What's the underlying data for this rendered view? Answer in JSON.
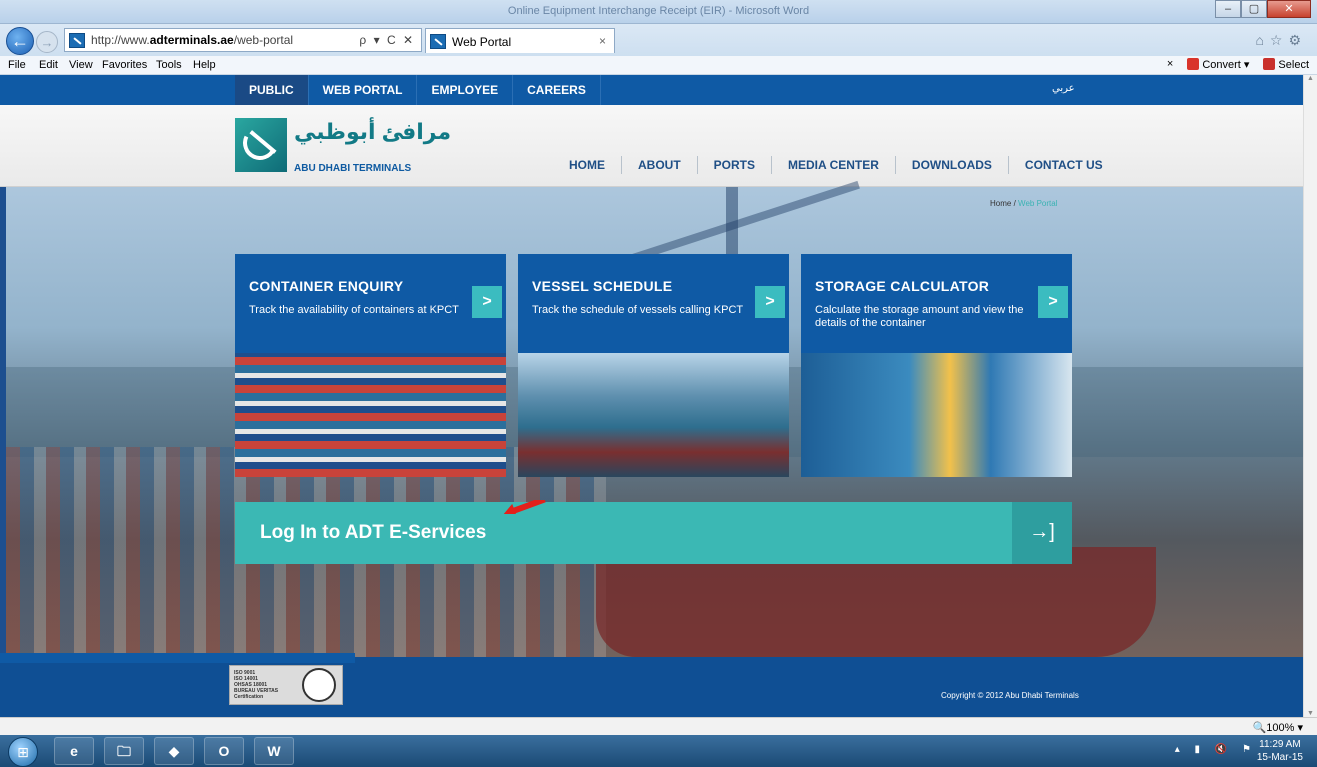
{
  "window": {
    "title": "Online Equipment Interchange Receipt (EIR) - Microsoft Word"
  },
  "browser": {
    "url_prefix": "http://www.",
    "url_domain": "adterminals.ae",
    "url_path": "/web-portal",
    "addr_tools": "ρ ▾ C ✕",
    "tab_title": "Web Portal",
    "tab_close": "×",
    "menu": [
      "File",
      "Edit",
      "View",
      "Favorites",
      "Tools",
      "Help"
    ],
    "toolbar_right": {
      "close": "×",
      "convert": "Convert",
      "select": "Select"
    },
    "zoom": "100%"
  },
  "site": {
    "top_nav": [
      "PUBLIC",
      "WEB PORTAL",
      "EMPLOYEE",
      "CAREERS"
    ],
    "arabic_link": "عربي",
    "logo_arabic": "مرافئ أبوظبي",
    "logo_english": "ABU DHABI TERMINALS",
    "main_nav": [
      "HOME",
      "ABOUT",
      "PORTS",
      "MEDIA CENTER",
      "DOWNLOADS",
      "CONTACT US"
    ],
    "breadcrumb": {
      "home": "Home",
      "sep": "/",
      "current": "Web Portal"
    },
    "cards": [
      {
        "title": "CONTAINER ENQUIRY",
        "desc": "Track the availability of containers at KPCT",
        "arrow": ">"
      },
      {
        "title": "VESSEL SCHEDULE",
        "desc": "Track the schedule of vessels calling KPCT",
        "arrow": ">"
      },
      {
        "title": "STORAGE CALCULATOR",
        "desc": "Calculate the storage amount and view the details of the container",
        "arrow": ">"
      }
    ],
    "login_label": "Log In to ADT E-Services",
    "login_icon": "→]",
    "cert_lines": [
      "ISO 9001",
      "ISO 14001",
      "OHSAS 18001",
      "BUREAU VERITAS",
      "Certification"
    ],
    "copyright": "Copyright © 2012 Abu Dhabi Terminals"
  },
  "taskbar": {
    "apps": [
      "e",
      "🗀",
      "◆",
      "O",
      "W"
    ],
    "time": "11:29 AM",
    "date": "15-Mar-15"
  },
  "colors": {
    "brand_blue": "#0f5aa5",
    "teal": "#3bb8b4",
    "arrow_red": "#e3201b"
  }
}
